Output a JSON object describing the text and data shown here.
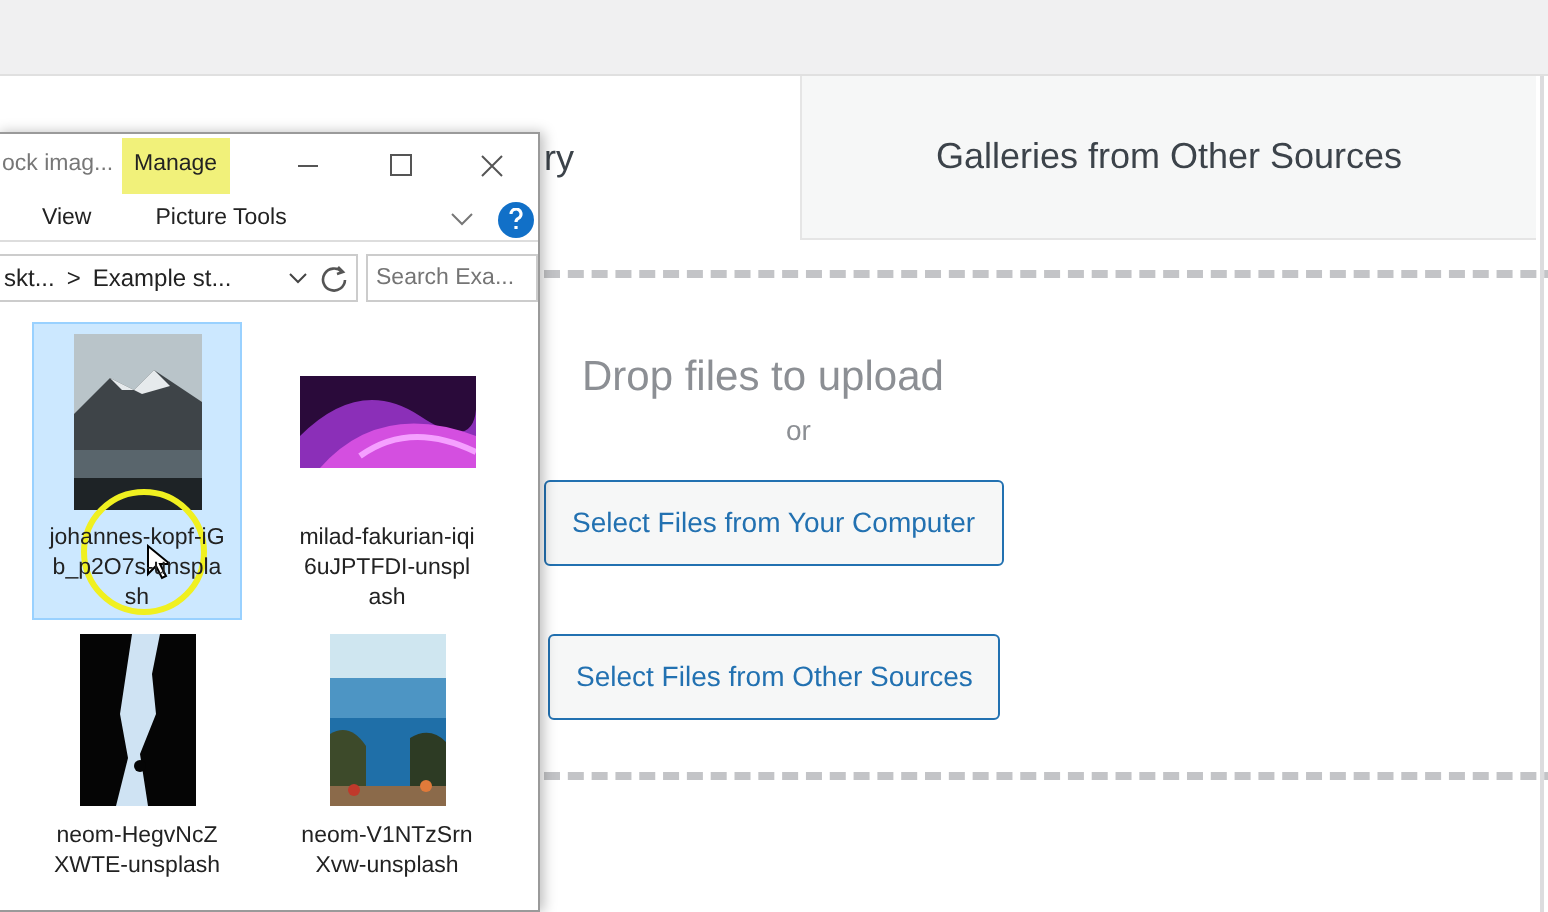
{
  "page": {
    "tabs": [
      {
        "label": "ry",
        "selected": true
      },
      {
        "label": "Galleries from Other Sources",
        "selected": false
      }
    ],
    "drop_zone": {
      "title": "Drop files to upload",
      "separator": "or",
      "buttons": [
        "Select Files from Your Computer",
        "Select Files from Other Sources"
      ]
    }
  },
  "explorer": {
    "title": "ock imag...",
    "context_tab": "Manage",
    "ribbon": [
      "View",
      "Picture Tools"
    ],
    "address": {
      "crumbs": [
        "skt...",
        "Example st..."
      ],
      "separator": ">"
    },
    "search": {
      "placeholder": "Search Exa..."
    },
    "files": [
      {
        "name": "johannes-kopf-iGb_p2O7s-unsplash",
        "selected": true
      },
      {
        "name": "milad-fakurian-iqi6uJPTFDI-unsplash",
        "selected": false
      },
      {
        "name": "neom-HegvNcZXWTE-unsplash",
        "selected": false
      },
      {
        "name": "neom-V1NTzSrnXvw-unsplash",
        "selected": false
      }
    ]
  }
}
